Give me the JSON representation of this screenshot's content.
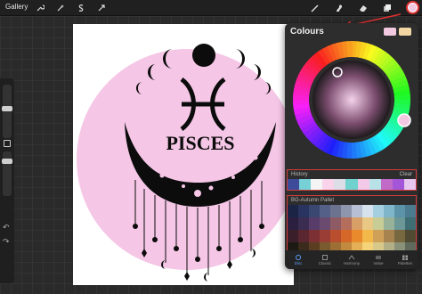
{
  "topbar": {
    "gallery_label": "Gallery",
    "left_tools": [
      "wrench-icon",
      "magic-wand-icon",
      "selection-icon",
      "transform-icon"
    ],
    "right_tools": [
      "brush-icon",
      "smudge-icon",
      "eraser-icon",
      "layers-icon"
    ],
    "current_color": "#f3c9e2"
  },
  "canvas": {
    "title_text": "PISCES",
    "pink": "#f5c6e6",
    "ink": "#0c0c0c"
  },
  "panel": {
    "title": "Colours",
    "primary_swatch": "#f3c9e2",
    "secondary_swatch": "#f1d6a4",
    "history": {
      "label": "History",
      "clear_label": "Clear",
      "colors": [
        "#3e4a9a",
        "#76d0d6",
        "#f5f5f5",
        "#f8d3ea",
        "#dddde8",
        "#6fd2cf",
        "#f2c9e6",
        "#b9e2e8",
        "#c16ac8",
        "#a357d8",
        "#e7c6ef"
      ]
    },
    "palette": {
      "label": "BG-Autumn Pallet",
      "rows": [
        [
          "#1c2445",
          "#293560",
          "#3a4770",
          "#546087",
          "#6b738f",
          "#8e96ae",
          "#b6bfd4",
          "#d6e3ee",
          "#a4cfe0",
          "#7fb6c9",
          "#5c93a8",
          "#4b7b8f"
        ],
        [
          "#2a1f3f",
          "#3b2c52",
          "#583d6a",
          "#6a4a6e",
          "#8e5a63",
          "#b46e5b",
          "#d8a066",
          "#e9c886",
          "#c8cc95",
          "#98b29a",
          "#6b9797",
          "#3e6d73"
        ],
        [
          "#3a1e2a",
          "#5a2630",
          "#7c3034",
          "#9a3d34",
          "#b94e2e",
          "#d56728",
          "#e98a2c",
          "#f2b84a",
          "#cfa058",
          "#a7844f",
          "#77683f",
          "#4f4a31"
        ],
        [
          "#1d1a14",
          "#3b2b1c",
          "#5b3e22",
          "#7a5a2f",
          "#9c6f34",
          "#c18a3e",
          "#e4b057",
          "#f5d479",
          "#d8c98b",
          "#b2af86",
          "#8a9179",
          "#5f6a5c"
        ]
      ]
    },
    "nav": [
      {
        "label": "Disc",
        "icon": "disc-icon",
        "active": true
      },
      {
        "label": "Classic",
        "icon": "square-icon",
        "active": false
      },
      {
        "label": "Harmony",
        "icon": "harmony-icon",
        "active": false
      },
      {
        "label": "Value",
        "icon": "value-icon",
        "active": false
      },
      {
        "label": "Palettes",
        "icon": "palettes-icon",
        "active": false
      }
    ]
  },
  "annotation": {
    "color": "#e03030"
  }
}
